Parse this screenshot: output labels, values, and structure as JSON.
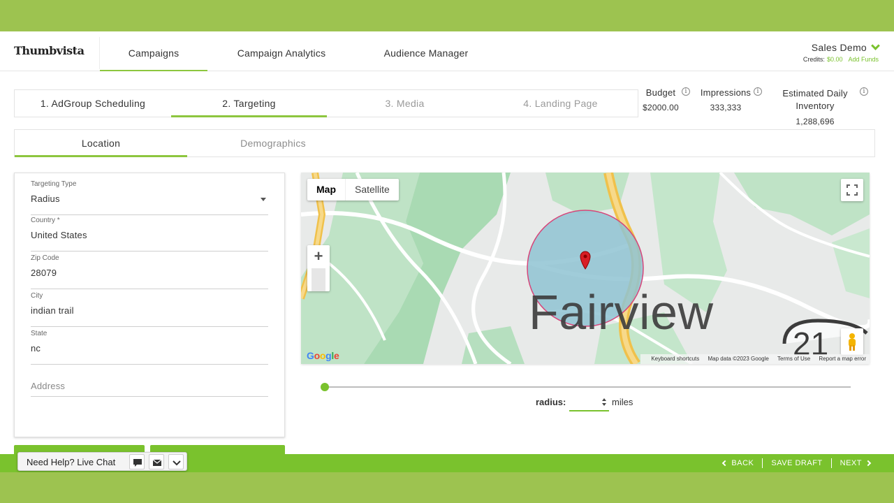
{
  "brand": {
    "logo_text": "Thumbvista",
    "accent": "#7ac22d"
  },
  "nav": [
    {
      "label": "Campaigns",
      "active": true
    },
    {
      "label": "Campaign Analytics",
      "active": false
    },
    {
      "label": "Audience Manager",
      "active": false
    }
  ],
  "user": {
    "name": "Sales Demo",
    "credits_label": "Credits:",
    "credits_value": "$0.00",
    "add_funds": "Add Funds"
  },
  "steps": [
    {
      "label": "1. AdGroup Scheduling",
      "state": "done"
    },
    {
      "label": "2. Targeting",
      "state": "active"
    },
    {
      "label": "3. Media",
      "state": "disabled"
    },
    {
      "label": "4. Landing Page",
      "state": "disabled"
    }
  ],
  "stats": {
    "budget": {
      "label": "Budget",
      "value": "$2000.00"
    },
    "impressions": {
      "label": "Impressions",
      "value": "333,333"
    },
    "inventory": {
      "label_line1": "Estimated Daily",
      "label_line2": "Inventory",
      "value": "1,288,696"
    },
    "info_glyph": "i"
  },
  "subtabs": [
    {
      "label": "Location",
      "active": true
    },
    {
      "label": "Demographics",
      "active": false
    }
  ],
  "form": {
    "targeting_type": {
      "label": "Targeting Type",
      "value": "Radius"
    },
    "country": {
      "label": "Country *",
      "value": "United States"
    },
    "zip": {
      "label": "Zip Code",
      "value": "28079"
    },
    "city": {
      "label": "City",
      "value": "indian trail"
    },
    "state": {
      "label": "State",
      "value": "nc"
    },
    "address": {
      "placeholder": "Address",
      "value": ""
    }
  },
  "map": {
    "type_map": "Map",
    "type_satellite": "Satellite",
    "zoom_in": "+",
    "zoom_out": "−",
    "place_label": "Fairview",
    "shield_label": "21",
    "google": [
      "G",
      "o",
      "o",
      "g",
      "l",
      "e"
    ],
    "google_colors": [
      "#4285f4",
      "#ea4335",
      "#fbbc05",
      "#4285f4",
      "#34a853",
      "#ea4335"
    ],
    "attrib": [
      "Keyboard shortcuts",
      "Map data ©2023 Google",
      "Terms of Use",
      "Report a map error"
    ],
    "circle_fill": "#8fc3d2",
    "circle_stroke": "#d6467a"
  },
  "radius": {
    "label": "radius:",
    "value": "",
    "unit": "miles",
    "slider_fraction": 0.0
  },
  "footer": {
    "back": "BACK",
    "save_draft": "SAVE DRAFT",
    "next": "NEXT"
  },
  "chat": {
    "label": "Need Help? Live Chat"
  }
}
